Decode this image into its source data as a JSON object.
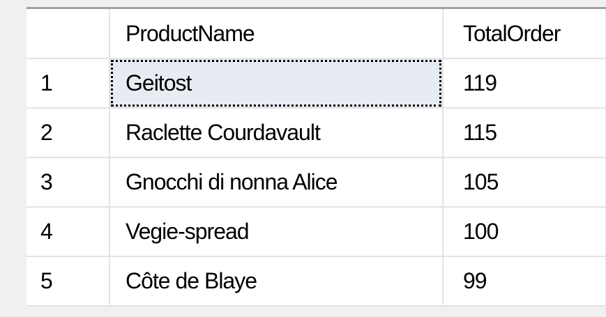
{
  "grid": {
    "columns": [
      "",
      "ProductName",
      "TotalOrder"
    ],
    "rows": [
      {
        "num": "1",
        "name": "Geitost",
        "total": "119"
      },
      {
        "num": "2",
        "name": "Raclette Courdavault",
        "total": "115"
      },
      {
        "num": "3",
        "name": "Gnocchi di nonna Alice",
        "total": "105"
      },
      {
        "num": "4",
        "name": "Vegie-spread",
        "total": "100"
      },
      {
        "num": "5",
        "name": "Côte de Blaye",
        "total": "99"
      }
    ],
    "selected_cell": {
      "row": 1,
      "column": "ProductName"
    }
  },
  "colors": {
    "background": "#f0f0f0",
    "cell": "#ffffff",
    "gridline": "#e3e3e3",
    "selected_cell": "#e6ecf2"
  }
}
